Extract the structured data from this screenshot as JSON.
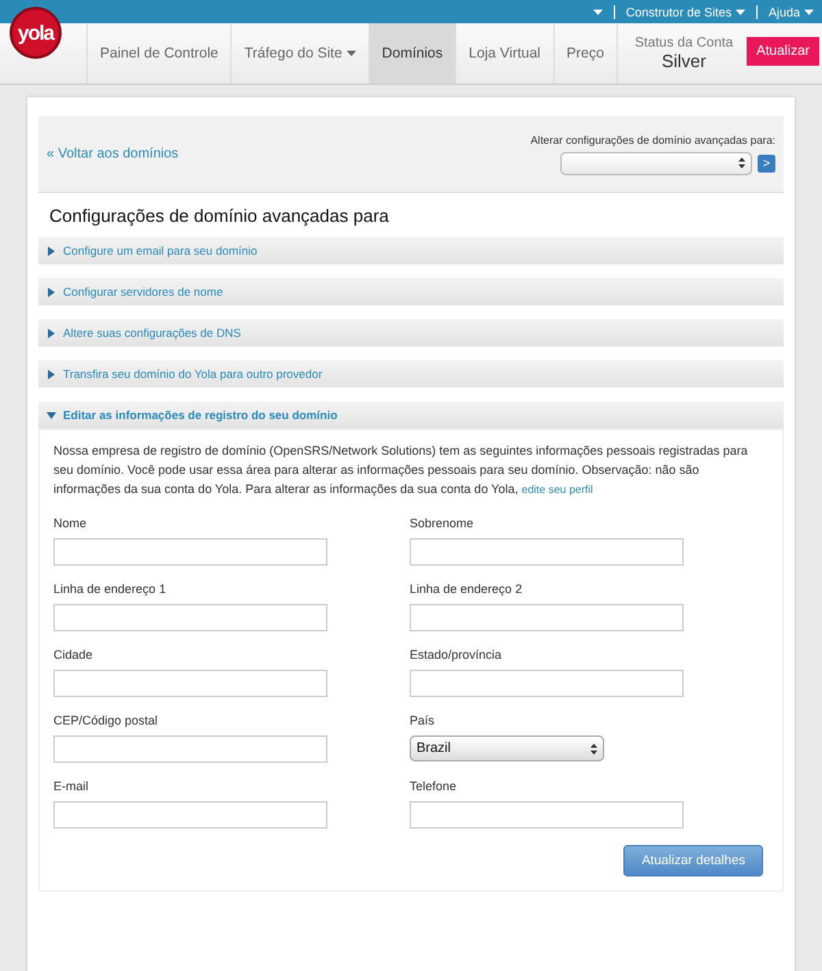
{
  "topbar": {
    "items": [
      {
        "kind": "menu"
      },
      {
        "kind": "link",
        "label": "Construtor de Sites"
      },
      {
        "kind": "link",
        "label": "Ajuda"
      }
    ]
  },
  "logo": "yola",
  "nav": [
    {
      "label": "Painel de Controle",
      "selected": false,
      "dropdown": false
    },
    {
      "label": "Tráfego do Site",
      "selected": false,
      "dropdown": true
    },
    {
      "label": "Domínios",
      "selected": true,
      "dropdown": false
    },
    {
      "label": "Loja Virtual",
      "selected": false,
      "dropdown": false
    },
    {
      "label": "Preço",
      "selected": false,
      "dropdown": false
    }
  ],
  "account": {
    "label": "Status da Conta",
    "plan": "Silver",
    "button": "Atualizar"
  },
  "back_link": "« Voltar aos domínios",
  "switcher": {
    "label": "Alterar configurações de domínio avançadas para:",
    "go": ">"
  },
  "title": "Configurações de domínio avançadas para",
  "sections": [
    {
      "label": "Configure um email para seu domínio",
      "expanded": false
    },
    {
      "label": "Configurar servidores de nome",
      "expanded": false
    },
    {
      "label": "Altere suas configurações de DNS",
      "expanded": false
    },
    {
      "label": "Transfira seu domínio do Yola para outro provedor",
      "expanded": false
    },
    {
      "label": "Editar as informações de registro do seu domínio",
      "expanded": true
    }
  ],
  "intro": "Nossa empresa de registro de domínio (OpenSRS/Network Solutions) tem as seguintes informações pessoais registradas para seu domínio. Você pode usar essa área para alterar as informações pessoais para seu domínio. Observação: não são informações da sua conta do Yola. Para alterar as informações da sua conta do Yola,",
  "intro_link": "edite seu perfil",
  "fields": [
    {
      "label": "Nome",
      "kind": "text"
    },
    {
      "label": "Sobrenome",
      "kind": "text"
    },
    {
      "label": "Linha de endereço 1",
      "kind": "text"
    },
    {
      "label": "Linha de endereço 2",
      "kind": "text"
    },
    {
      "label": "Cidade",
      "kind": "text"
    },
    {
      "label": "Estado/província",
      "kind": "text"
    },
    {
      "label": "CEP/Código postal",
      "kind": "text"
    },
    {
      "label": "País",
      "kind": "select",
      "value": "Brazil"
    },
    {
      "label": "E-mail",
      "kind": "text"
    },
    {
      "label": "Telefone",
      "kind": "text"
    }
  ],
  "submit": "Atualizar detalhes"
}
